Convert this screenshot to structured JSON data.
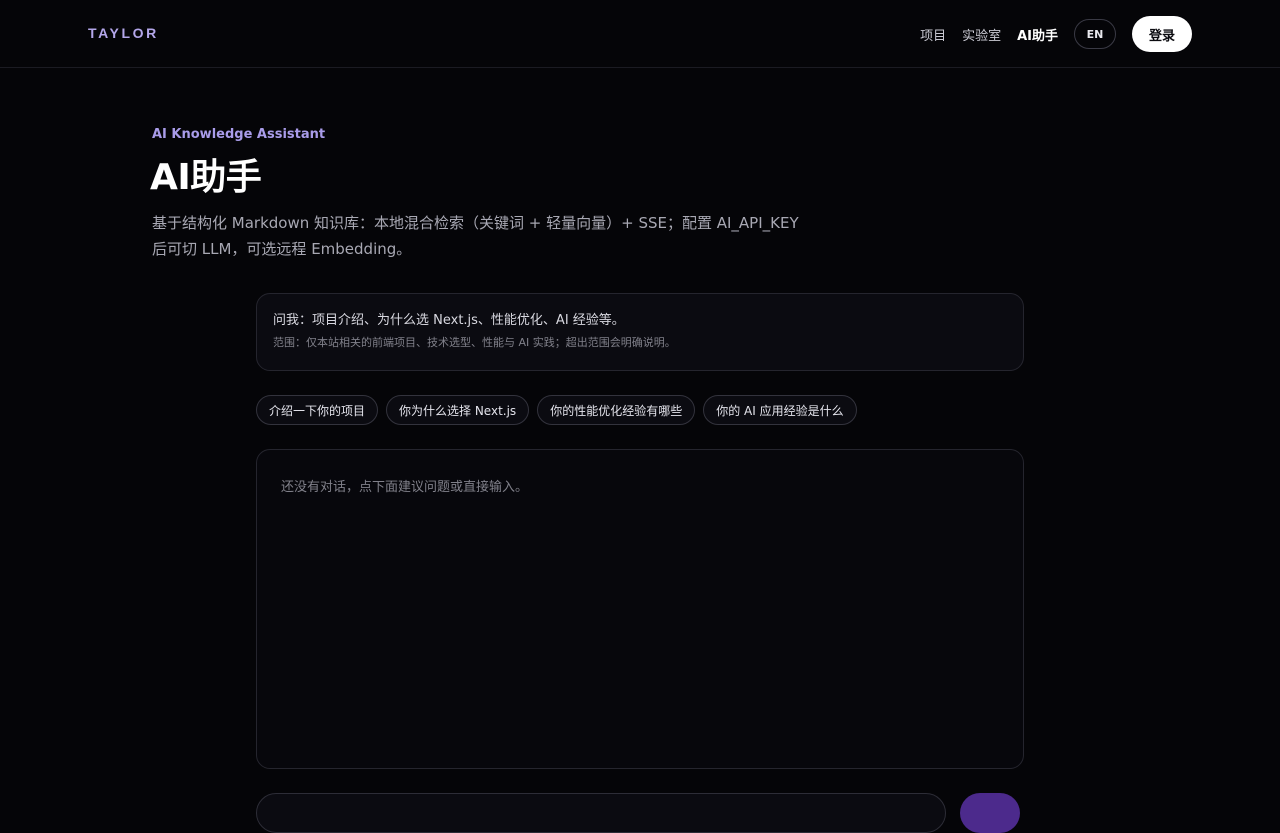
{
  "header": {
    "brand": "TAYLOR",
    "nav": [
      {
        "label": "项目",
        "active": false
      },
      {
        "label": "实验室",
        "active": false
      },
      {
        "label": "AI助手",
        "active": true
      }
    ],
    "lang_label": "EN",
    "login_label": "登录"
  },
  "hero": {
    "eyebrow": "AI Knowledge Assistant",
    "title": "AI助手",
    "description_line1": "基于结构化 Markdown 知识库：本地混合检索（关键词 + 轻量向量）+ SSE；配置 AI_API_KEY",
    "description_line2": "后可切 LLM，可选远程 Embedding。"
  },
  "info": {
    "main": "问我：项目介绍、为什么选 Next.js、性能优化、AI 经验等。",
    "sub": "范围：仅本站相关的前端项目、技术选型、性能与 AI 实践；超出范围会明确说明。"
  },
  "suggestions": [
    "介绍一下你的项目",
    "你为什么选择 Next.js",
    "你的性能优化经验有哪些",
    "你的 AI 应用经验是什么"
  ],
  "chat": {
    "empty_text": "还没有对话，点下面建议问题或直接输入。"
  },
  "composer": {
    "placeholder": "",
    "send_label": ""
  },
  "colors": {
    "background": "#050508",
    "accent": "#a99ce9",
    "send_button": "#4c2a8c"
  }
}
